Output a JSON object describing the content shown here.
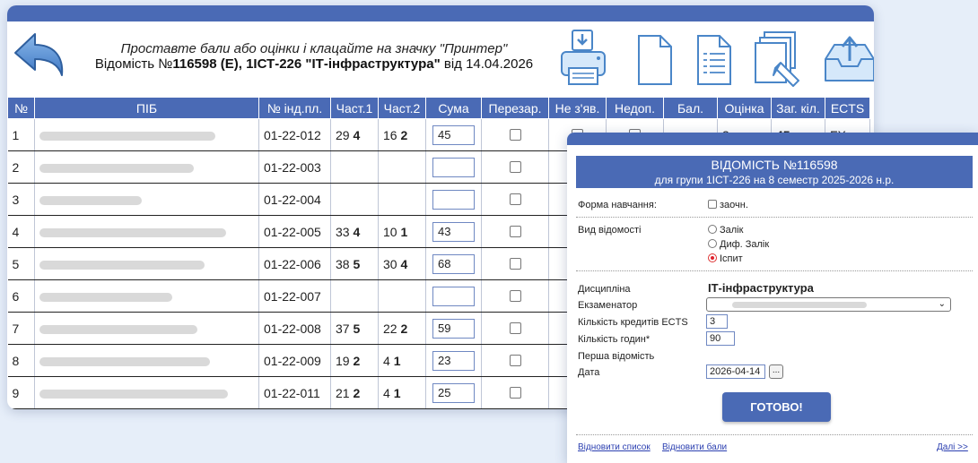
{
  "header": {
    "instruction": "Проставте бали або оцінки і клацайте на значку \"Принтер\"",
    "title_prefix": "Відомість №",
    "sheet_id": "116598 (Е), 1ІСТ-226 \"ІТ-інфраструктура\"",
    "title_suffix": " від 14.04.2026"
  },
  "toolbar": {
    "icons": [
      "printer-icon",
      "blank-page-icon",
      "list-page-icon",
      "edit-pages-icon",
      "upload-tray-icon"
    ]
  },
  "table": {
    "columns": [
      "№",
      "ПІБ",
      "№ інд.пл.",
      "Част.1",
      "Част.2",
      "Сума",
      "Перезар.",
      "Не з'яв.",
      "Недоп.",
      "Бал.",
      "Оцінка",
      "Заг. кіл.",
      "ECTS"
    ],
    "rows": [
      {
        "no": "1",
        "id": "01-22-012",
        "p1": "29",
        "g1": "4",
        "p2": "16",
        "g2": "2",
        "sum": "45"
      },
      {
        "no": "2",
        "id": "01-22-003",
        "p1": "",
        "g1": "",
        "p2": "",
        "g2": "",
        "sum": ""
      },
      {
        "no": "3",
        "id": "01-22-004",
        "p1": "",
        "g1": "",
        "p2": "",
        "g2": "",
        "sum": ""
      },
      {
        "no": "4",
        "id": "01-22-005",
        "p1": "33",
        "g1": "4",
        "p2": "10",
        "g2": "1",
        "sum": "43"
      },
      {
        "no": "5",
        "id": "01-22-006",
        "p1": "38",
        "g1": "5",
        "p2": "30",
        "g2": "4",
        "sum": "68"
      },
      {
        "no": "6",
        "id": "01-22-007",
        "p1": "",
        "g1": "",
        "p2": "",
        "g2": "",
        "sum": ""
      },
      {
        "no": "7",
        "id": "01-22-008",
        "p1": "37",
        "g1": "5",
        "p2": "22",
        "g2": "2",
        "sum": "59"
      },
      {
        "no": "8",
        "id": "01-22-009",
        "p1": "19",
        "g1": "2",
        "p2": "4",
        "g2": "1",
        "sum": "23"
      },
      {
        "no": "9",
        "id": "01-22-011",
        "p1": "21",
        "g1": "2",
        "p2": "4",
        "g2": "1",
        "sum": "25"
      }
    ],
    "row1_extra": {
      "grade": "3",
      "total": "45",
      "ects": "FX"
    }
  },
  "dialog": {
    "title": "ВІДОМІСТЬ №116598",
    "subtitle": "для групи 1ІСТ-226 на 8 семестр 2025-2026 н.р.",
    "form_label": "Форма навчання:",
    "form_option": "заочн.",
    "type_label": "Вид відомості",
    "type_options": [
      "Залік",
      "Диф. Залік",
      "Іспит"
    ],
    "selected_type": "Іспит",
    "discipline_label": "Дисципліна",
    "discipline_value": "ІТ-інфраструктура",
    "examiner_label": "Екзаменатор",
    "credits_label": "Кількість кредитів ECTS",
    "credits_value": "3",
    "hours_label": "Кількість годин*",
    "hours_value": "90",
    "first_label": "Перша відомість",
    "date_label": "Дата",
    "date_value": "2026-04-14",
    "date_btn": "...",
    "ok_button": "ГОТОВО!",
    "link_restore_list": "Відновити список",
    "link_restore_scores": "Відновити бали",
    "link_next": "Далі >>"
  },
  "colors": {
    "accent": "#4a6ab5",
    "background": "#e6eef9",
    "radio_selected": "#e0202c"
  }
}
